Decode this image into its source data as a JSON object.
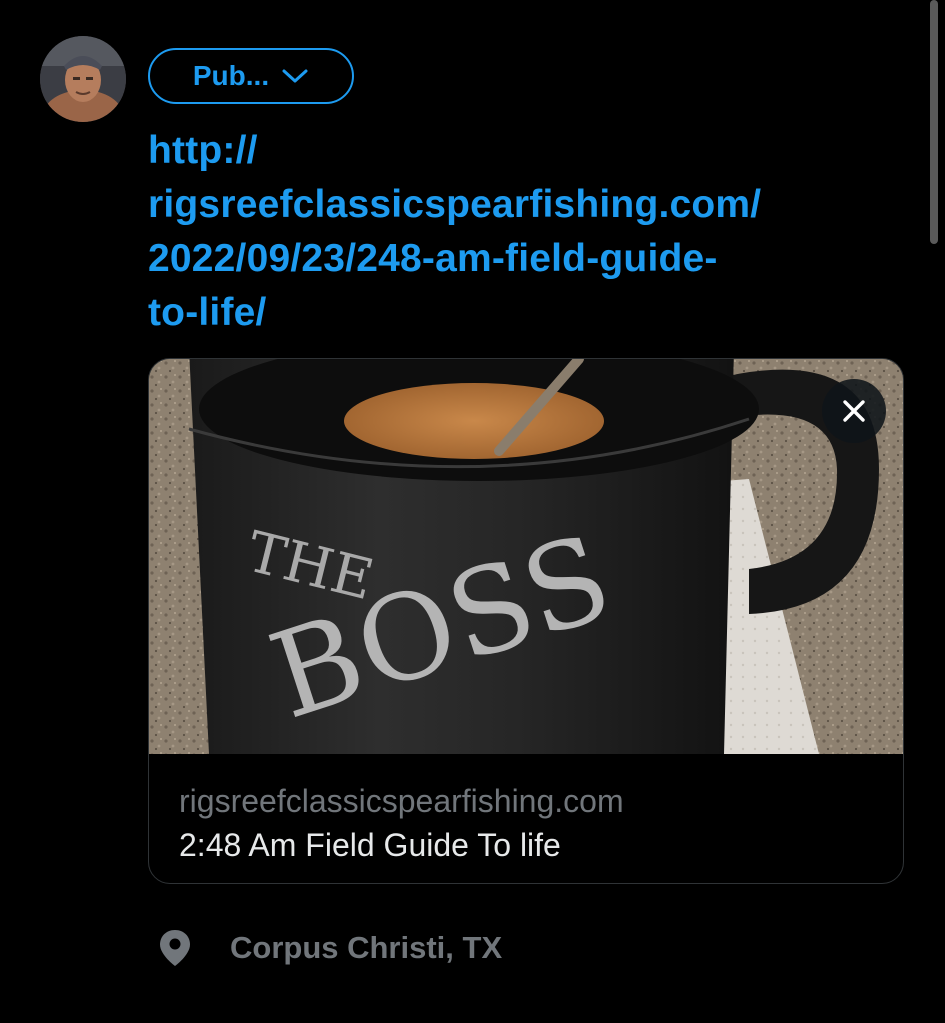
{
  "composer": {
    "audience_label": "Pub...",
    "link_lines": [
      "http://",
      "rigsreefclassicspearfishing.com/",
      "2022/09/23/248-am-field-guide-",
      "to-life/"
    ],
    "avatar_icon": "user-avatar",
    "audience_icon": "chevron-down-icon"
  },
  "link_card": {
    "image_text_the": "THE",
    "image_text_boss": "BOSS",
    "domain": "rigsreefclassicspearfishing.com",
    "title": "2:48 Am Field Guide To life",
    "close_icon": "close-icon"
  },
  "location": {
    "label": "Corpus Christi, TX",
    "icon": "location-pin-icon"
  },
  "colors": {
    "background": "#000000",
    "accent": "#1d9bf0",
    "secondary_text": "#71767b",
    "primary_text": "#e7e9ea",
    "card_border": "#2f3336"
  }
}
